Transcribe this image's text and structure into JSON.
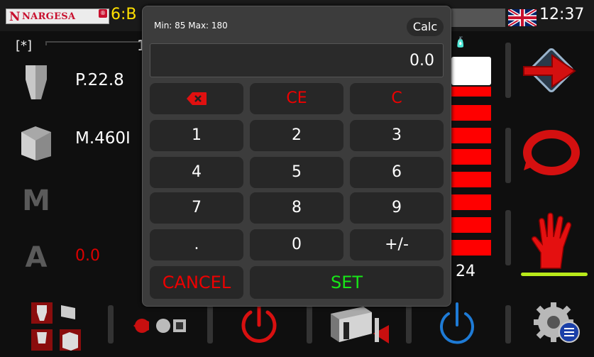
{
  "header": {
    "logo_initial": "N",
    "logo_text": "NARGESA",
    "logo_reg": "®",
    "program": "6:B",
    "flag_icon": "uk-flag-icon",
    "clock": "12:37"
  },
  "left": {
    "indicator": "[*]",
    "row_number": "1",
    "punch_label": "P.22.8",
    "die_label": "M.460I",
    "m_icon": "M",
    "a_icon": "A",
    "a_value": "0.0"
  },
  "right": {
    "bottom_number": "24",
    "cap_icon": "🧴",
    "nav_icons": [
      "arrow-right-icon",
      "cycle-icon",
      "hand-stop-icon"
    ]
  },
  "bottom": {
    "icons": [
      "tool-selection-icon",
      "sequence-icon",
      "power-icon",
      "backgauge-icon",
      "reset-icon",
      "settings-icon"
    ]
  },
  "keypad": {
    "range_text": "Min: 85 Max: 180",
    "calc_label": "Calc",
    "display_value": "0.0",
    "keys": {
      "ce": "CE",
      "c": "C",
      "k1": "1",
      "k2": "2",
      "k3": "3",
      "k4": "4",
      "k5": "5",
      "k6": "6",
      "k7": "7",
      "k8": "8",
      "k9": "9",
      "dot": ".",
      "k0": "0",
      "sign": "+/-",
      "cancel": "CANCEL",
      "set": "SET"
    }
  },
  "colors": {
    "accent_red": "#ff0000",
    "set_green": "#17e617",
    "program_yellow": "#ffe000",
    "hand_line": "#b8ea1a",
    "refresh_blue": "#1e7bd6"
  }
}
